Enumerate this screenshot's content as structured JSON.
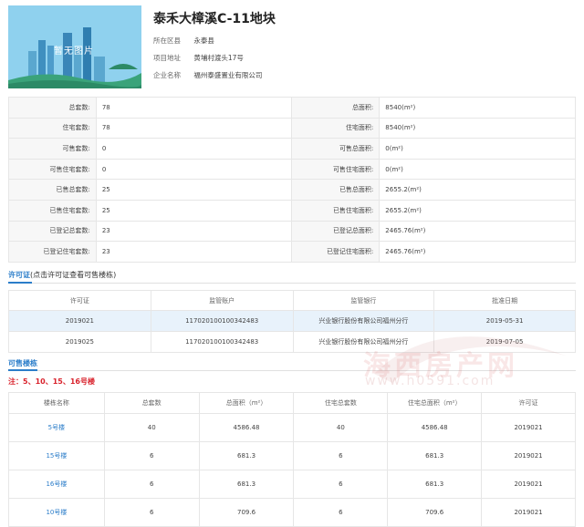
{
  "project": {
    "thumbnail_text": "暂无图片",
    "title": "泰禾大樟溪C-11地块",
    "info": [
      {
        "label": "所在区县",
        "value": "永泰县"
      },
      {
        "label": "项目地址",
        "value": "黄埔村渡头17号"
      },
      {
        "label": "企业名称",
        "value": "福州泰盛置业有限公司"
      }
    ]
  },
  "stats": [
    {
      "l1": "总套数:",
      "v1": "78",
      "l2": "总面积:",
      "v2": "8540(m²)"
    },
    {
      "l1": "住宅套数:",
      "v1": "78",
      "l2": "住宅面积:",
      "v2": "8540(m²)"
    },
    {
      "l1": "可售套数:",
      "v1": "0",
      "l2": "可售总面积:",
      "v2": "0(m²)"
    },
    {
      "l1": "可售住宅套数:",
      "v1": "0",
      "l2": "可售住宅面积:",
      "v2": "0(m²)"
    },
    {
      "l1": "已售总套数:",
      "v1": "25",
      "l2": "已售总面积:",
      "v2": "2655.2(m²)"
    },
    {
      "l1": "已售住宅套数:",
      "v1": "25",
      "l2": "已售住宅面积:",
      "v2": "2655.2(m²)"
    },
    {
      "l1": "已登记总套数:",
      "v1": "23",
      "l2": "已登记总面积:",
      "v2": "2465.76(m²)"
    },
    {
      "l1": "已登记住宅套数:",
      "v1": "23",
      "l2": "已登记住宅面积:",
      "v2": "2465.76(m²)"
    }
  ],
  "permit_section": {
    "title": "许可证",
    "note": "(点击许可证查看可售楼栋)",
    "headers": [
      "许可证",
      "监管账户",
      "监管银行",
      "批准日期"
    ],
    "rows": [
      {
        "cells": [
          "2019021",
          "117020100100342483",
          "兴业银行股份有限公司福州分行",
          "2019-05-31"
        ]
      },
      {
        "cells": [
          "2019025",
          "117020100100342483",
          "兴业银行股份有限公司福州分行",
          "2019-07-05"
        ]
      }
    ]
  },
  "building_section": {
    "title": "可售楼栋",
    "remark": "注：5、10、15、16号楼",
    "headers": [
      "楼栋名称",
      "总套数",
      "总面积（m²）",
      "住宅总套数",
      "住宅总面积（m²）",
      "许可证"
    ],
    "rows": [
      {
        "cells": [
          "5号楼",
          "40",
          "4586.48",
          "40",
          "4586.48",
          "2019021"
        ]
      },
      {
        "cells": [
          "15号楼",
          "6",
          "681.3",
          "6",
          "681.3",
          "2019021"
        ]
      },
      {
        "cells": [
          "16号楼",
          "6",
          "681.3",
          "6",
          "681.3",
          "2019021"
        ]
      },
      {
        "cells": [
          "10号楼",
          "6",
          "709.6",
          "6",
          "709.6",
          "2019021"
        ]
      }
    ]
  },
  "watermark": {
    "name": "海西房产网",
    "url": "www.h0591.com"
  },
  "colors": {
    "accent": "#2b7dc9",
    "remark": "#d9232d",
    "highlight_row": "#e8f2fb"
  }
}
